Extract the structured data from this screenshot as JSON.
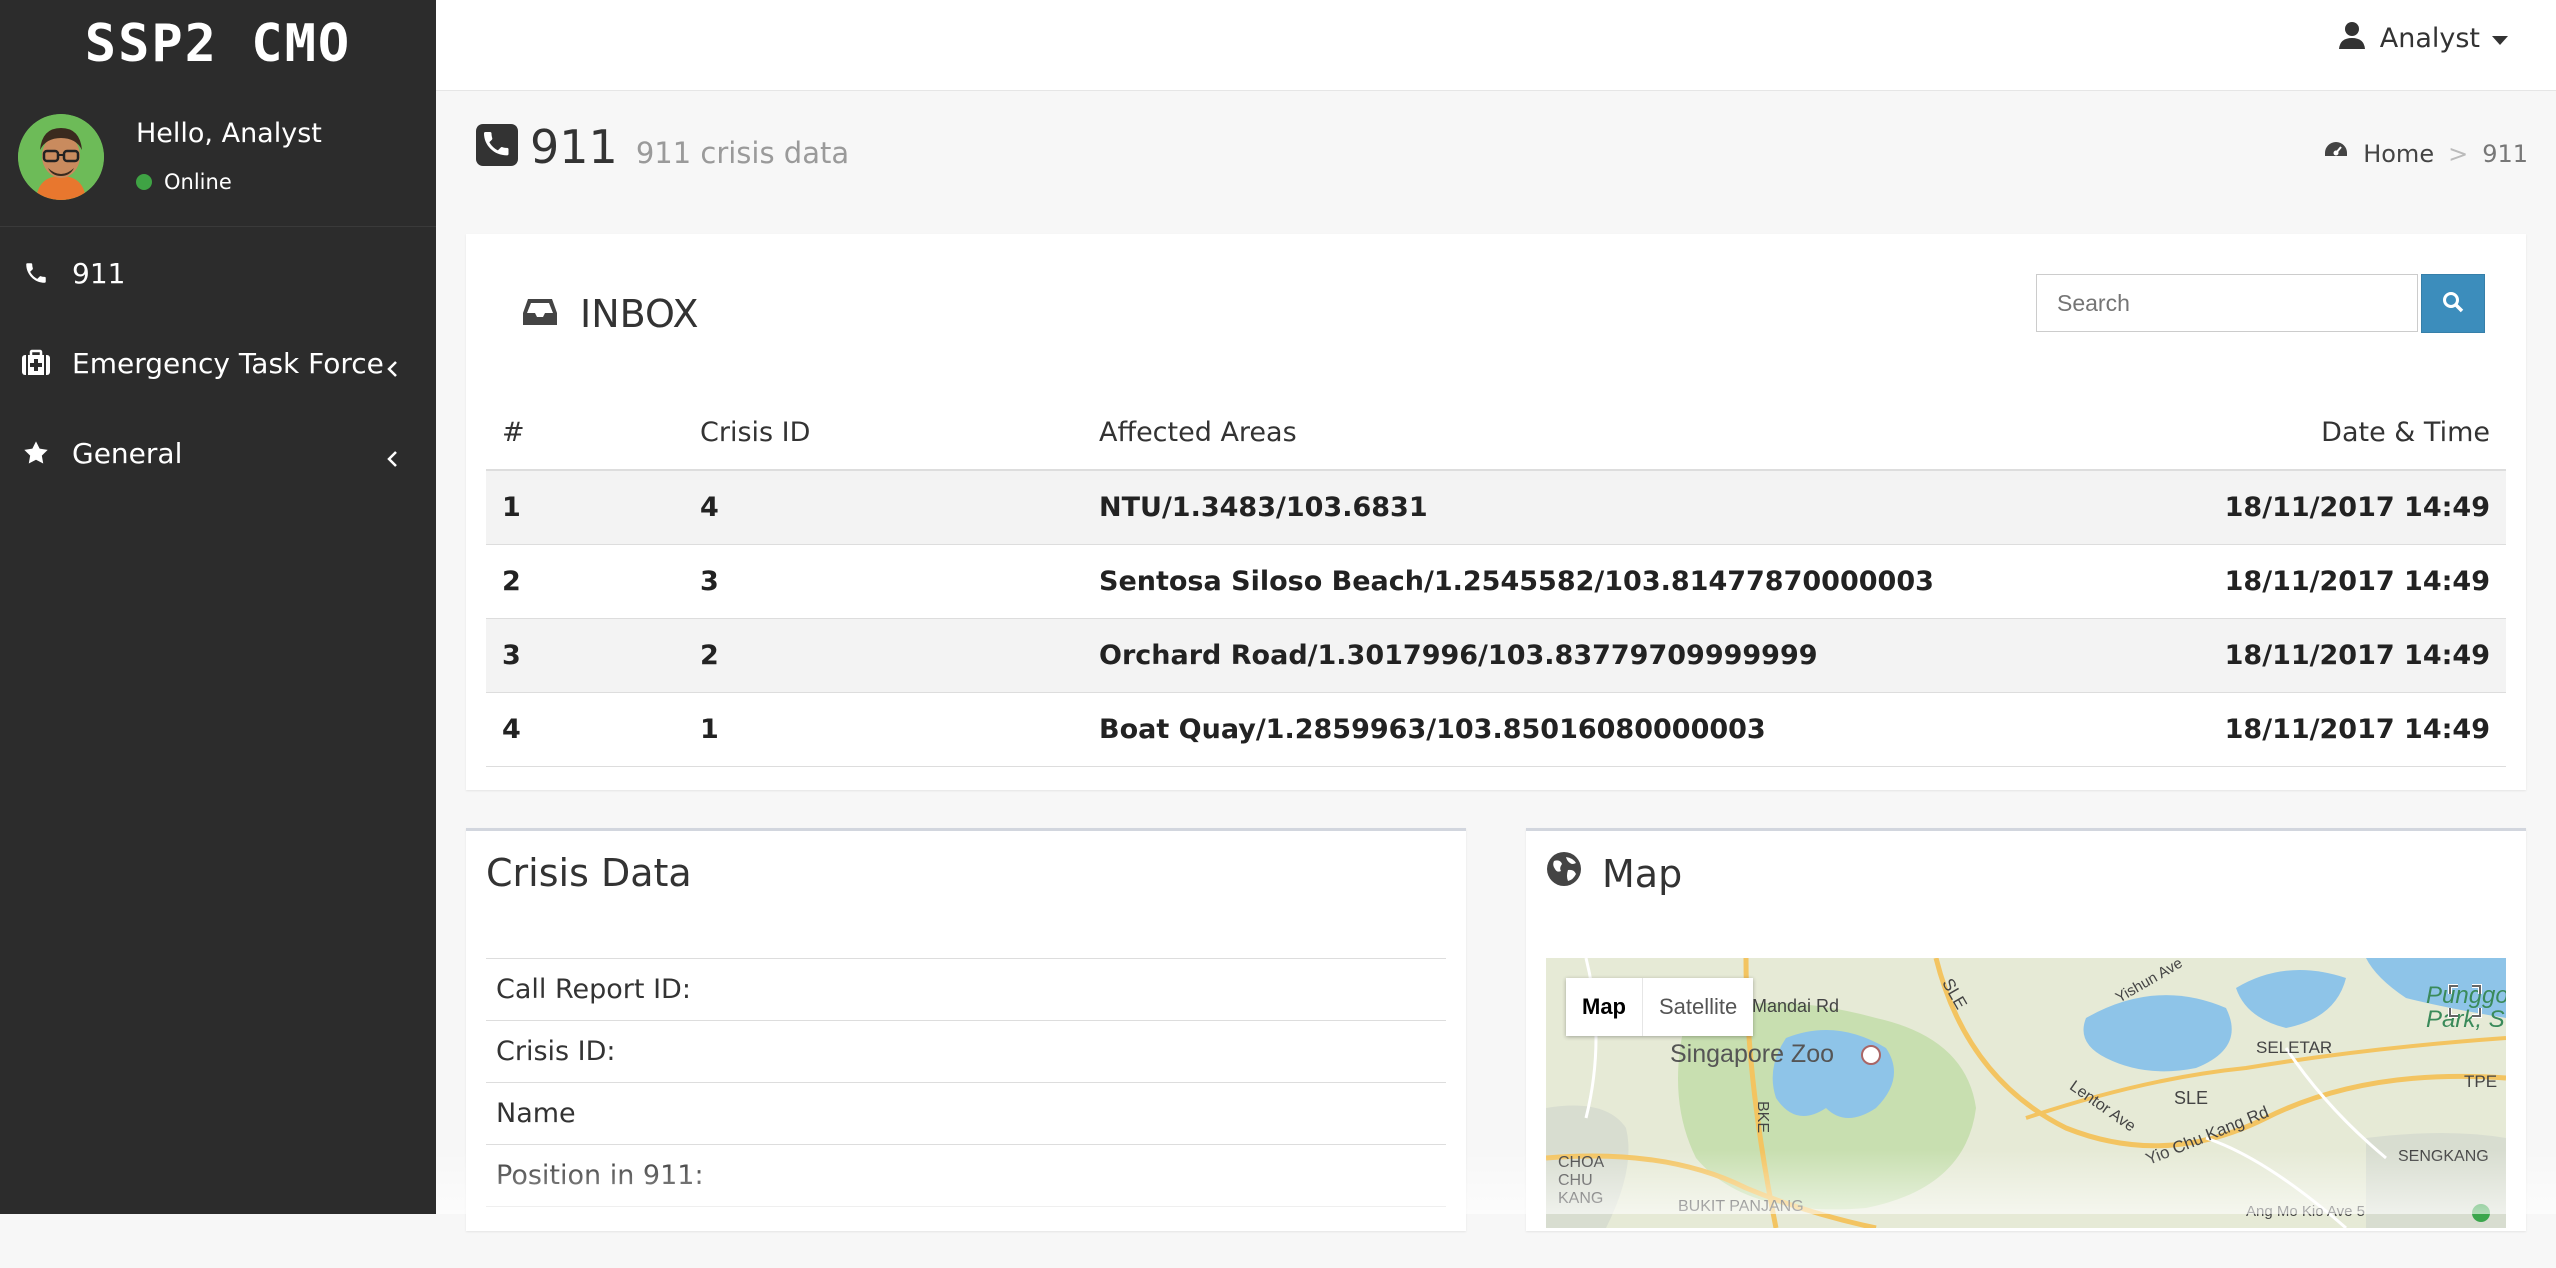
{
  "brand": "SSP2 CMO",
  "user": {
    "greeting": "Hello, Analyst",
    "status": "Online",
    "menu_label": "Analyst"
  },
  "sidebar": {
    "items": [
      {
        "label": "911",
        "icon": "phone-icon"
      },
      {
        "label": "Emergency Task Force",
        "icon": "medkit-icon"
      },
      {
        "label": "General",
        "icon": "star-icon"
      }
    ]
  },
  "page": {
    "title": "911",
    "subtitle": "911 crisis data"
  },
  "breadcrumb": {
    "home": "Home",
    "sep": ">",
    "current": "911"
  },
  "inbox": {
    "title": "INBOX",
    "search_placeholder": "Search",
    "columns": [
      "#",
      "Crisis ID",
      "Affected Areas",
      "Date & Time"
    ],
    "rows": [
      {
        "num": "1",
        "crisis_id": "4",
        "area": "NTU/1.3483/103.6831",
        "datetime": "18/11/2017 14:49"
      },
      {
        "num": "2",
        "crisis_id": "3",
        "area": "Sentosa Siloso Beach/1.2545582/103.81477870000003",
        "datetime": "18/11/2017 14:49"
      },
      {
        "num": "3",
        "crisis_id": "2",
        "area": "Orchard Road/1.3017996/103.83779709999999",
        "datetime": "18/11/2017 14:49"
      },
      {
        "num": "4",
        "crisis_id": "1",
        "area": "Boat Quay/1.2859963/103.85016080000003",
        "datetime": "18/11/2017 14:49"
      }
    ]
  },
  "crisis_data": {
    "title": "Crisis Data",
    "fields": [
      "Call Report ID:",
      "Crisis ID:",
      "Name",
      "Position in 911:"
    ]
  },
  "map": {
    "title": "Map",
    "type_map": "Map",
    "type_satellite": "Satellite",
    "labels": {
      "mandai": "Mandai Rd",
      "zoo": "Singapore Zoo",
      "sle": "SLE",
      "seletar": "SELETAR",
      "tpe": "TPE",
      "lentor": "Lentor Ave",
      "sle2": "SLE",
      "yiochukang": "Yio Chu Kang Rd",
      "choachukang": "CHOA CHU KANG",
      "bke": "BKE",
      "sengkang": "SENGKANG",
      "bukitpanjang": "BUKIT PANJANG",
      "yishun": "Yishun Ave",
      "punggol": "Punggol Park, S",
      "angmokio": "Ang Mo Kio Ave 5"
    }
  },
  "colors": {
    "sidebar_bg": "#2c2c2c",
    "accent": "#3c8dbc",
    "online": "#3fa344"
  }
}
